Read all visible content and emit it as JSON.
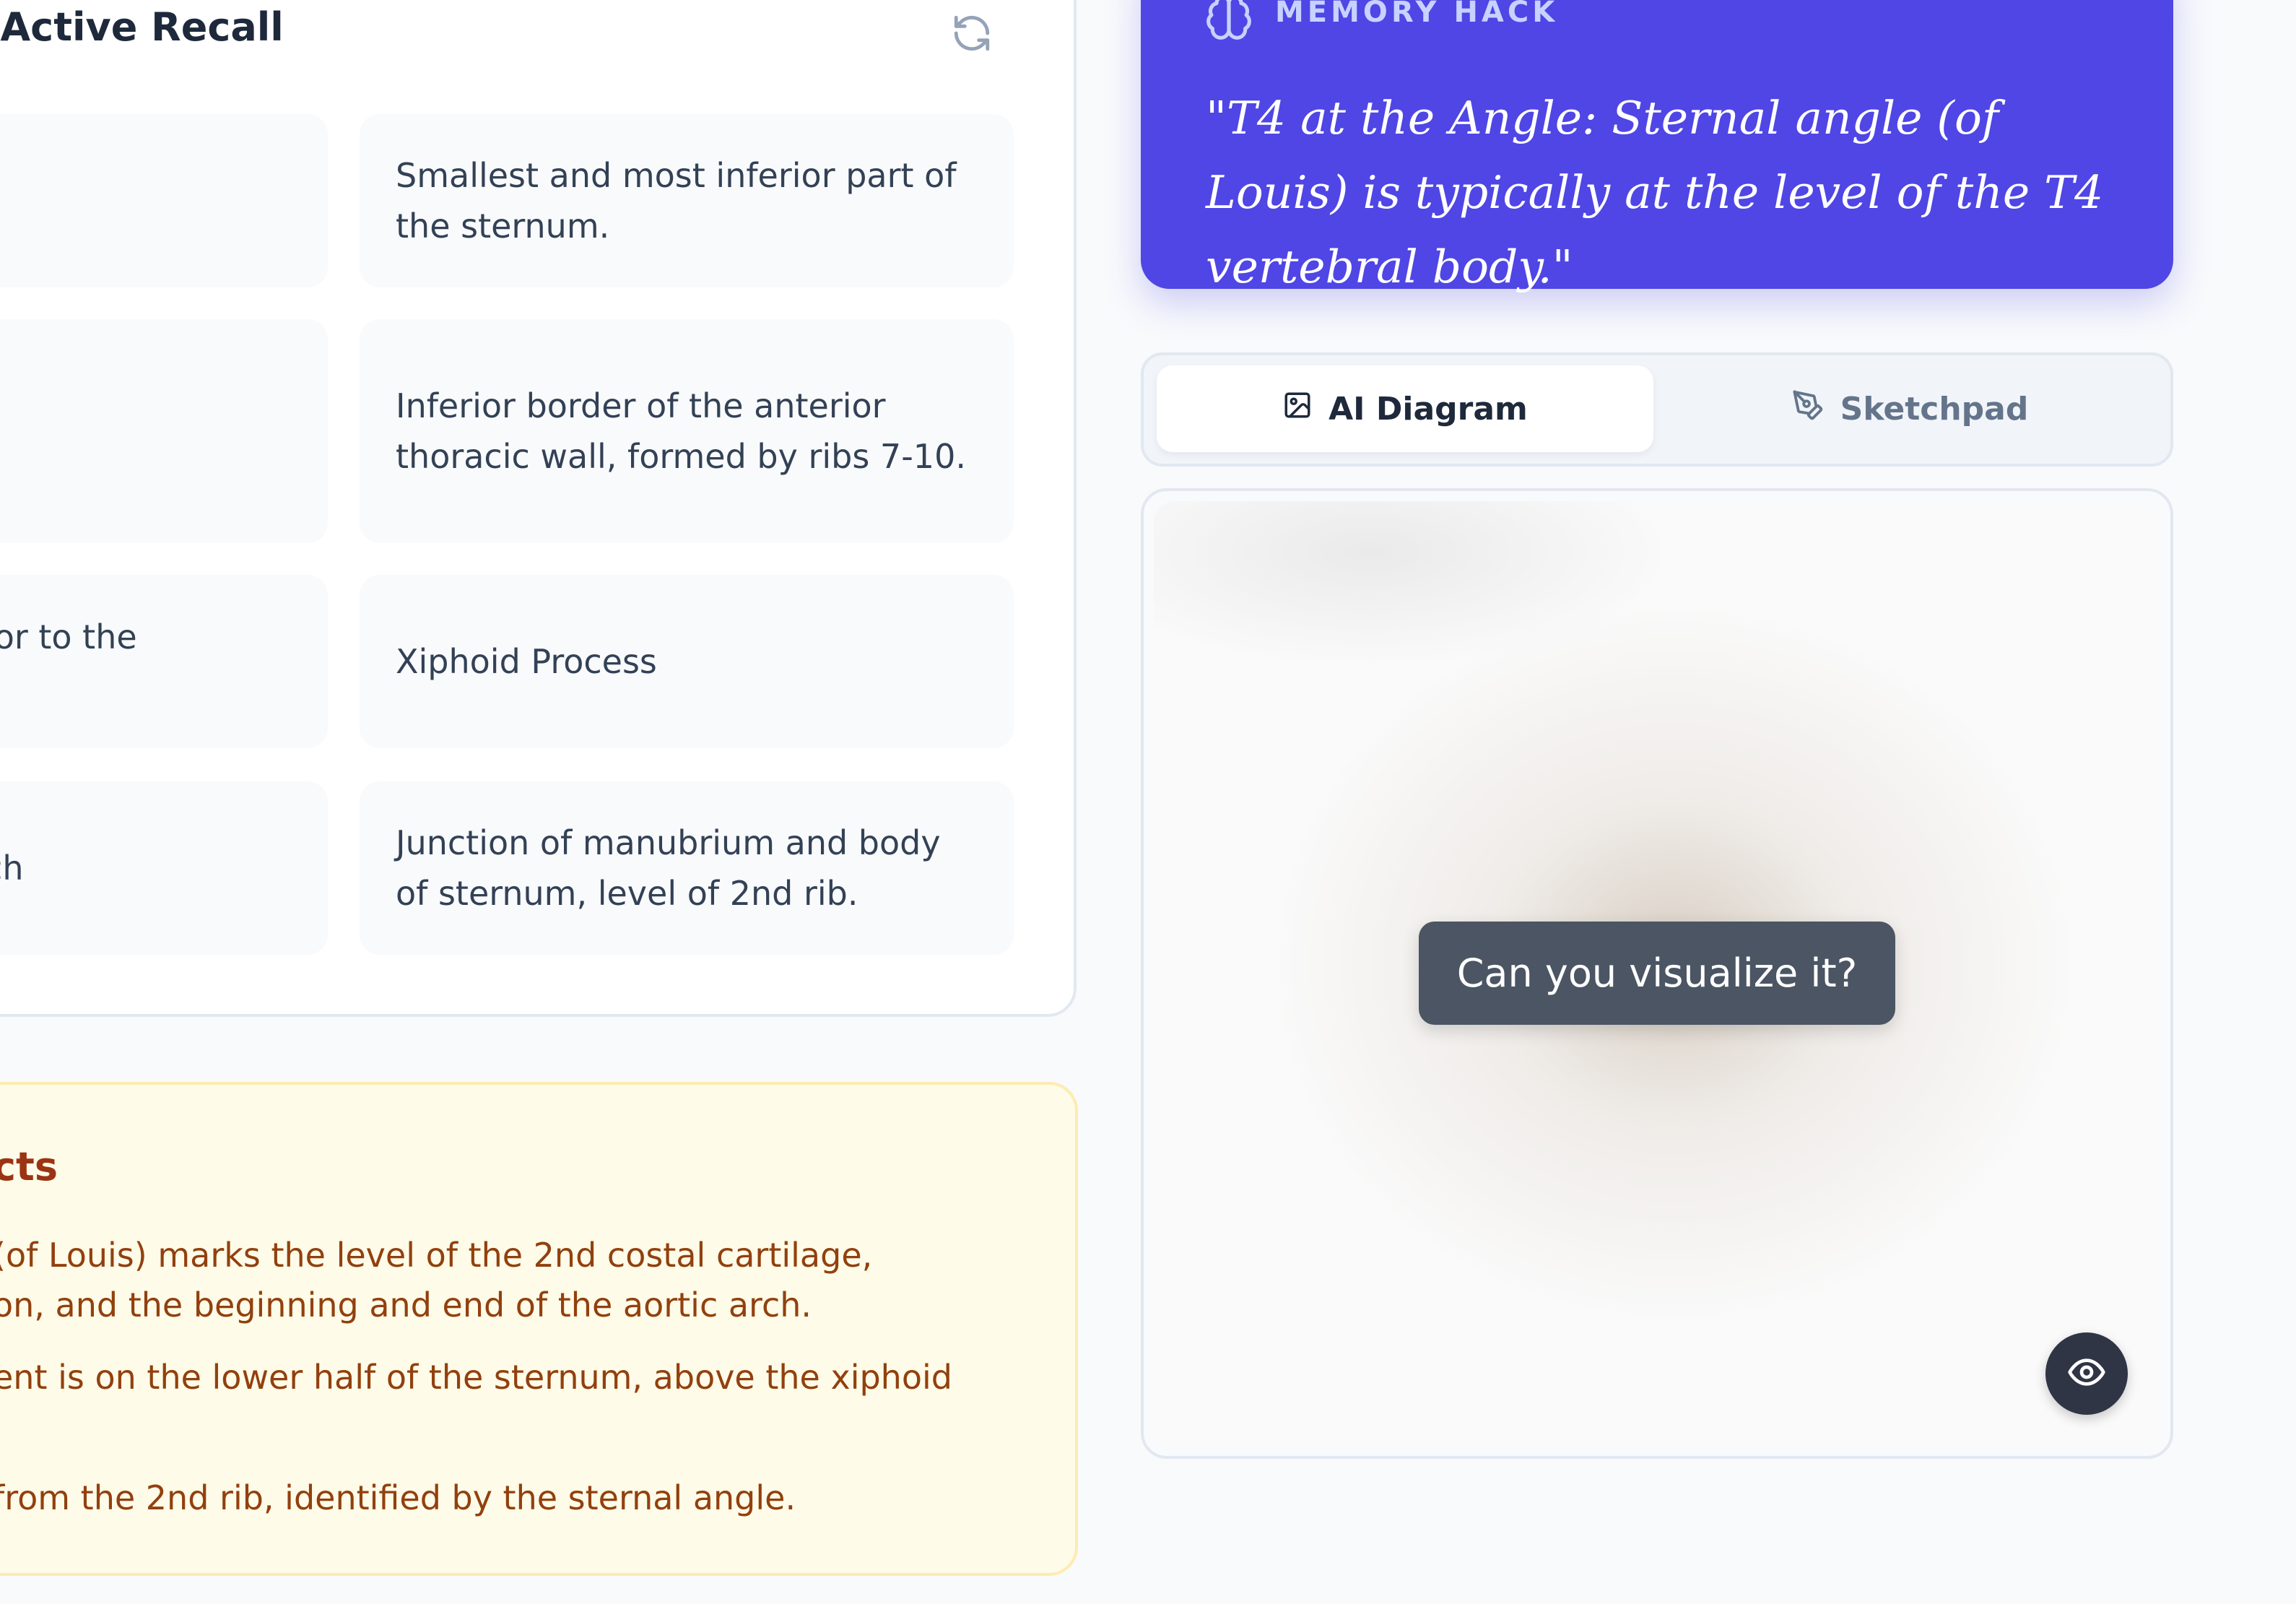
{
  "recall": {
    "title": ": Active Recall",
    "rows": [
      {
        "left": "",
        "right": "Smallest and most inferior part of the sternum."
      },
      {
        "left": "",
        "right": "Inferior border of the anterior thoracic wall, formed by ribs 7-10."
      },
      {
        "left": "rior to the",
        "right": "Xiphoid Process"
      },
      {
        "left": "tch",
        "right": "Junction of manubrium and body of sternum, level of 2nd rib."
      }
    ]
  },
  "facts": {
    "title": "cts",
    "lines": [
      " (of Louis) marks the level of the 2nd costal cartilage,",
      "on, and the beginning and end of the aortic arch.",
      "ent is on the lower half of the sternum, above the xiphoid",
      "from the 2nd rib, identified by the sternal angle."
    ]
  },
  "memory": {
    "label": "MEMORY HACK",
    "quote": "\"T4 at the Angle: Sternal angle (of Louis) is typically at the level of the T4 vertebral body.\""
  },
  "tabs": [
    {
      "label": "AI Diagram",
      "icon": "image-icon",
      "active": true
    },
    {
      "label": "Sketchpad",
      "icon": "pen-tool-icon",
      "active": false
    }
  ],
  "diagram": {
    "prompt": "Can you visualize it?",
    "reveal_icon": "eye-icon"
  },
  "colors": {
    "accent": "#4f46e5",
    "facts_text": "#92400e",
    "facts_bg": "#fefbe8"
  }
}
